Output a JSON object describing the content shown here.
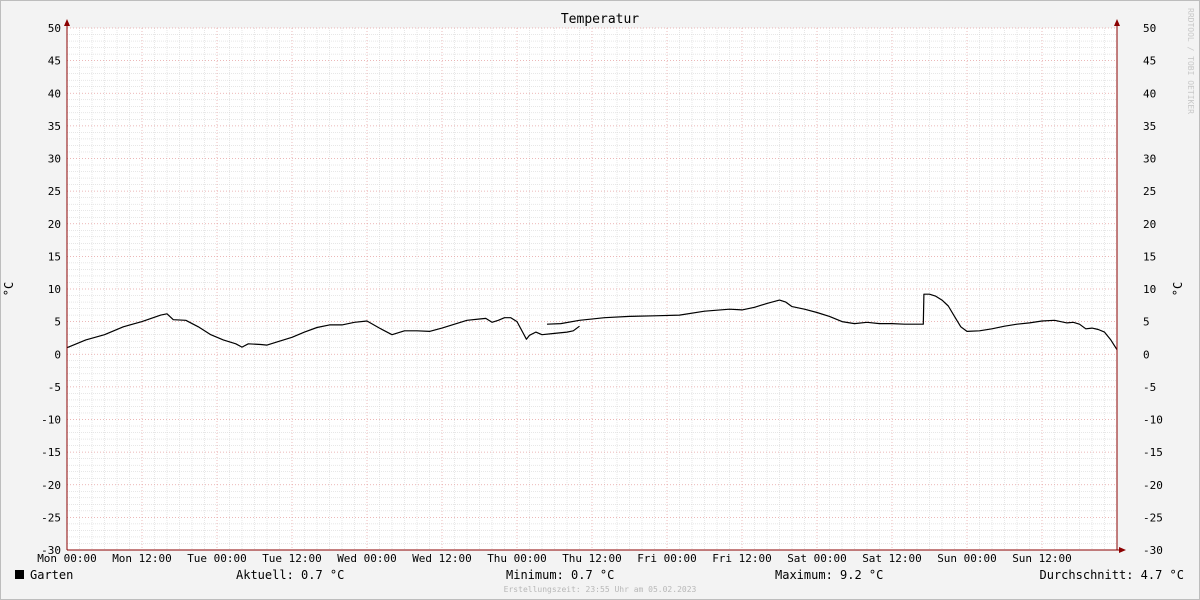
{
  "chart_data": {
    "type": "line",
    "title": "Temperatur",
    "ylabel": "°C",
    "ylim": [
      -30,
      50
    ],
    "yticks": [
      50,
      45,
      40,
      35,
      30,
      25,
      20,
      15,
      10,
      5,
      0,
      -5,
      -10,
      -15,
      -20,
      -25,
      -30
    ],
    "xlim_hours": [
      0,
      168
    ],
    "xtick_labels": [
      "Mon 00:00",
      "Mon 12:00",
      "Tue 00:00",
      "Tue 12:00",
      "Wed 00:00",
      "Wed 12:00",
      "Thu 00:00",
      "Thu 12:00",
      "Fri 00:00",
      "Fri 12:00",
      "Sat 00:00",
      "Sat 12:00",
      "Sun 00:00",
      "Sun 12:00"
    ],
    "grid": true,
    "series": [
      {
        "name": "Garten",
        "color": "#000000",
        "points": [
          [
            0,
            1.0
          ],
          [
            3,
            2.2
          ],
          [
            6,
            3.0
          ],
          [
            9,
            4.2
          ],
          [
            12,
            5.0
          ],
          [
            15,
            6.0
          ],
          [
            16,
            6.2
          ],
          [
            17,
            5.3
          ],
          [
            19,
            5.2
          ],
          [
            21,
            4.2
          ],
          [
            23,
            3.0
          ],
          [
            25,
            2.2
          ],
          [
            27,
            1.6
          ],
          [
            28,
            1.1
          ],
          [
            29,
            1.6
          ],
          [
            31,
            1.5
          ],
          [
            32,
            1.4
          ],
          [
            34,
            2.0
          ],
          [
            36,
            2.6
          ],
          [
            38,
            3.4
          ],
          [
            40,
            4.1
          ],
          [
            42,
            4.5
          ],
          [
            44,
            4.5
          ],
          [
            46,
            4.9
          ],
          [
            48,
            5.1
          ],
          [
            50,
            4.0
          ],
          [
            52,
            3.0
          ],
          [
            54,
            3.6
          ],
          [
            56,
            3.6
          ],
          [
            58,
            3.5
          ],
          [
            60,
            4.0
          ],
          [
            62,
            4.6
          ],
          [
            64,
            5.2
          ],
          [
            66,
            5.4
          ],
          [
            67,
            5.5
          ],
          [
            68,
            4.9
          ],
          [
            69,
            5.2
          ],
          [
            70,
            5.6
          ],
          [
            71,
            5.6
          ],
          [
            72,
            5.0
          ],
          [
            73,
            3.2
          ],
          [
            73.5,
            2.3
          ],
          [
            74,
            2.9
          ],
          [
            75,
            3.4
          ],
          [
            76,
            3.0
          ],
          [
            78,
            3.2
          ],
          [
            80,
            3.4
          ],
          [
            81,
            3.6
          ],
          [
            82,
            4.3
          ]
        ]
      },
      {
        "name": "Garten",
        "color": "#000000",
        "points": [
          [
            76.8,
            4.6
          ],
          [
            79,
            4.7
          ],
          [
            82,
            5.2
          ],
          [
            86,
            5.6
          ],
          [
            90,
            5.8
          ],
          [
            94,
            5.9
          ],
          [
            98,
            6.0
          ],
          [
            102,
            6.6
          ],
          [
            106,
            6.9
          ],
          [
            108,
            6.8
          ],
          [
            110,
            7.2
          ],
          [
            112,
            7.8
          ],
          [
            114,
            8.3
          ],
          [
            115,
            8.0
          ],
          [
            116,
            7.3
          ],
          [
            118,
            6.9
          ],
          [
            120,
            6.4
          ],
          [
            122,
            5.8
          ],
          [
            124,
            5.0
          ],
          [
            126,
            4.7
          ],
          [
            128,
            4.9
          ],
          [
            130,
            4.7
          ],
          [
            132,
            4.7
          ],
          [
            134,
            4.6
          ],
          [
            136,
            4.6
          ],
          [
            137,
            4.6
          ],
          [
            137.1,
            9.2
          ],
          [
            138,
            9.2
          ],
          [
            139,
            8.9
          ],
          [
            140,
            8.3
          ],
          [
            141,
            7.4
          ],
          [
            142,
            5.8
          ],
          [
            143,
            4.2
          ],
          [
            144,
            3.5
          ],
          [
            146,
            3.6
          ],
          [
            148,
            3.9
          ],
          [
            150,
            4.3
          ],
          [
            152,
            4.6
          ],
          [
            154,
            4.8
          ],
          [
            156,
            5.1
          ],
          [
            158,
            5.2
          ],
          [
            160,
            4.8
          ],
          [
            161,
            4.9
          ],
          [
            162,
            4.6
          ],
          [
            163,
            3.9
          ],
          [
            164,
            4.0
          ],
          [
            165,
            3.8
          ],
          [
            166,
            3.4
          ],
          [
            167,
            2.2
          ],
          [
            168,
            0.7
          ]
        ]
      }
    ],
    "legend": {
      "name": "Garten",
      "aktuell": "Aktuell: 0.7 °C",
      "minimum": "Minimum: 0.7 °C",
      "maximum": "Maximum: 9.2 °C",
      "durchschnitt": "Durchschnitt: 4.7 °C"
    },
    "footer": "Erstellungszeit: 23:55 Uhr am 05.02.2023",
    "watermark": "RRDTOOL / TOBI OETIKER",
    "colors": {
      "background": "#f3f3f3",
      "plot_area": "#ffffff",
      "major_grid": "#e6a0a0",
      "minor_grid": "#cfcfcf",
      "axis": "#8b0000",
      "line": "#000000"
    }
  }
}
